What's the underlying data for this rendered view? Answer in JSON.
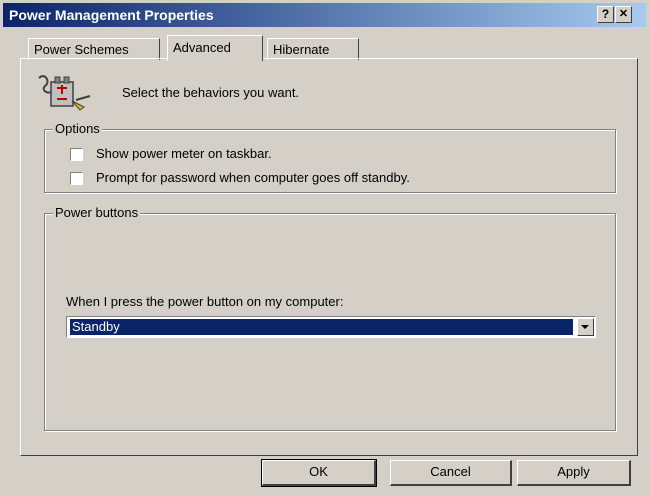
{
  "window": {
    "title": "Power Management Properties",
    "help_label": "?",
    "close_label": "✕"
  },
  "tabs": [
    {
      "label": "Power Schemes",
      "active": false
    },
    {
      "label": "Advanced",
      "active": true
    },
    {
      "label": "Hibernate",
      "active": false
    }
  ],
  "header": {
    "text": "Select the behaviors you want.",
    "icon": "power-plug-icon"
  },
  "options": {
    "legend": "Options",
    "items": [
      {
        "label": "Show power meter on taskbar.",
        "checked": false
      },
      {
        "label": "Prompt for password when computer goes off standby.",
        "checked": false
      }
    ]
  },
  "power_buttons": {
    "legend": "Power buttons",
    "prompt": "When I press the power button on my computer:",
    "selected": "Standby"
  },
  "buttons": {
    "ok": "OK",
    "cancel": "Cancel",
    "apply": "Apply"
  }
}
